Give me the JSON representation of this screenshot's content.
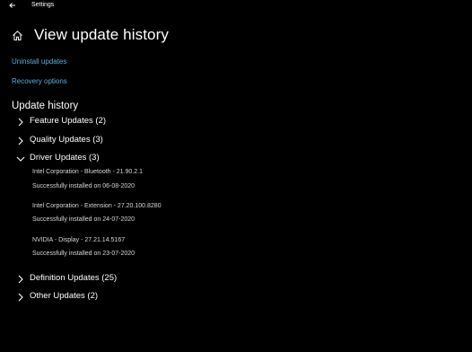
{
  "window": {
    "title": "Settings"
  },
  "header": {
    "title": "View update history"
  },
  "links": {
    "uninstall": "Uninstall updates",
    "recovery": "Recovery options"
  },
  "history": {
    "heading": "Update history",
    "groups": {
      "feature": "Feature Updates (2)",
      "quality": "Quality Updates (3)",
      "driver": "Driver Updates (3)",
      "definition": "Definition Updates (25)",
      "other": "Other Updates (2)"
    },
    "driver_entries": [
      {
        "name": "Intel Corporation - Bluetooth - 21.90.2.1",
        "status": "Successfully installed on 06-08-2020"
      },
      {
        "name": "Intel Corporation - Extension - 27.20.100.8280",
        "status": "Successfully installed on 24-07-2020"
      },
      {
        "name": "NVIDIA - Display - 27.21.14.5167",
        "status": "Successfully installed on 23-07-2020"
      }
    ]
  },
  "colors": {
    "background": "#000000",
    "text": "#ffffff",
    "link": "#5aaee0",
    "secondary_text": "#d8d8d8"
  },
  "icons": {
    "back": "back-arrow-icon",
    "home": "home-icon",
    "expand": "chevron-right-icon",
    "collapse": "chevron-down-icon"
  }
}
